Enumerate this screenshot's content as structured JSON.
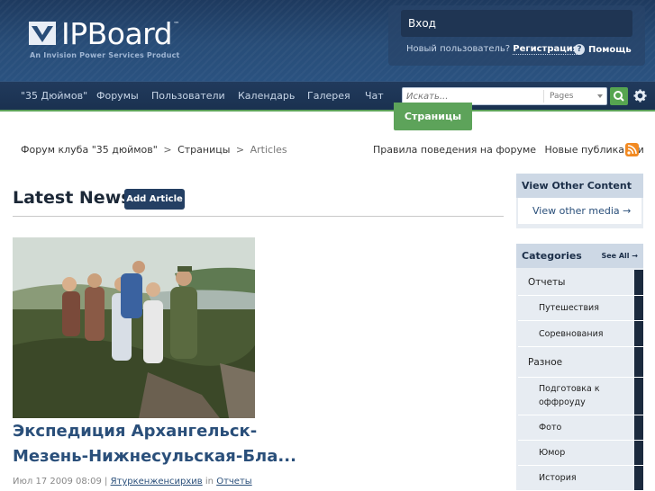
{
  "header": {
    "logo_text": "IPBoard",
    "logo_tm": "™",
    "logo_sub": "An Invision Power Services Product",
    "login_label": "Вход",
    "new_user_text": "Новый пользователь?",
    "register_label": "Регистрация",
    "help_label": "Помощь"
  },
  "nav": {
    "items": [
      "\"35 Дюймов\"",
      "Форумы",
      "Пользователи",
      "Календарь",
      "Галерея",
      "Чат"
    ],
    "active_tab": "Страницы",
    "search_placeholder": "Искать...",
    "search_scope": "Pages"
  },
  "breadcrumb": {
    "items": [
      "Форум клуба \"35 дюймов\"",
      "Страницы",
      "Articles"
    ],
    "separator": ">"
  },
  "top_links": {
    "rules": "Правила поведения на форуме",
    "new_posts": "Новые публикации"
  },
  "main": {
    "title": "Latest News",
    "add_article": "Add Article",
    "article": {
      "title": "Экспедиция Архангельск-Мезень-Нижнесульская-Бла...",
      "date": "Июл 17 2009 08:09",
      "sep": "|",
      "author": "Ятуркенженсирхив",
      "in_word": "in",
      "category": "Отчеты"
    }
  },
  "sidebar": {
    "other": {
      "title": "View Other Content",
      "link": "View other media →"
    },
    "categories": {
      "title": "Categories",
      "see_all": "See All →",
      "items": [
        {
          "label": "Отчеты",
          "level": "top"
        },
        {
          "label": "Путешествия",
          "level": "sub"
        },
        {
          "label": "Соревнования",
          "level": "sub"
        },
        {
          "label": "Разное",
          "level": "top"
        },
        {
          "label": "Подготовка к оффроуду",
          "level": "sub"
        },
        {
          "label": "Фото",
          "level": "sub"
        },
        {
          "label": "Юмор",
          "level": "sub"
        },
        {
          "label": "История",
          "level": "sub"
        }
      ]
    }
  },
  "colors": {
    "header_bg": "#284d78",
    "nav_bg": "#1a3150",
    "accent_green": "#5da35a",
    "link_blue": "#2a4f7a",
    "rss_orange": "#f28a22"
  }
}
